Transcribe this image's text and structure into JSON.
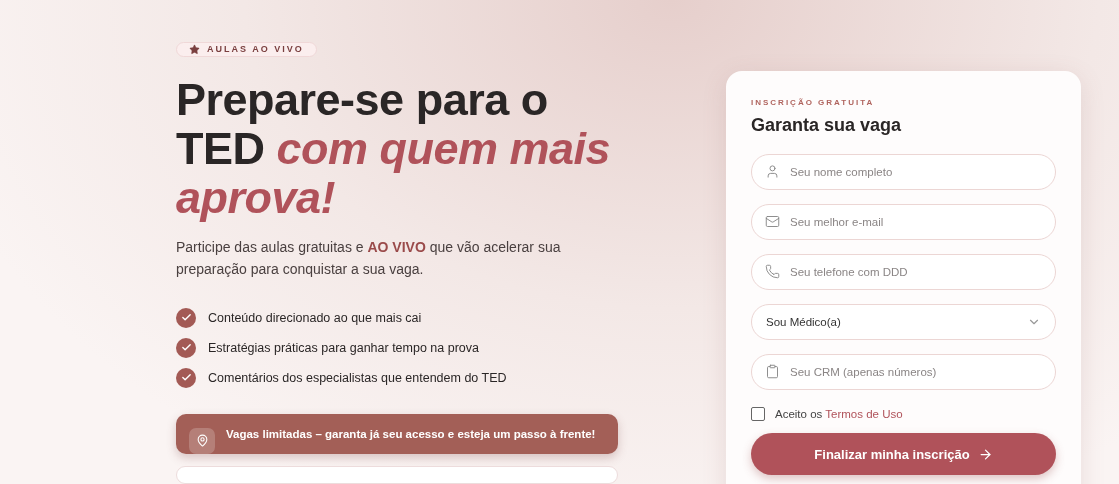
{
  "badge": {
    "label": "AULAS AO VIVO"
  },
  "headline": "Prepare-se para o TED *com quem mais aprova!*",
  "intro": "Participe das aulas gratuitas e **AO VIVO** que vão acelerar sua preparação para conquistar a sua vaga.",
  "benefits": [
    "Conteúdo direcionado ao que mais cai",
    "Estratégias práticas para ganhar tempo na prova",
    "Comentários dos especialistas que entendem do TED"
  ],
  "notice": "Vagas limitadas – garanta já seu acesso e esteja um passo à frente!",
  "form": {
    "eyebrow": "INSCRIÇÃO GRATUITA",
    "title": "Garanta sua vaga",
    "fields": [
      {
        "kind": "text",
        "placeholder": "Seu nome completo"
      },
      {
        "kind": "text",
        "placeholder": "Seu melhor e-mail"
      },
      {
        "kind": "text",
        "placeholder": "Seu telefone com DDD"
      },
      {
        "kind": "select",
        "value": "Sou Médico(a)"
      },
      {
        "kind": "text",
        "placeholder": "Seu CRM (apenas números)"
      }
    ],
    "terms": {
      "checked": false,
      "text": "Aceito os",
      "link": "Termos de Uso"
    },
    "submit": "Finalizar minha inscrição"
  }
}
